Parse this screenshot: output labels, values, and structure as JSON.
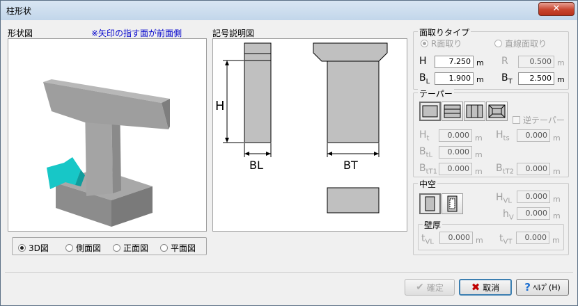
{
  "window": {
    "title": "柱形状",
    "close_label": "✕"
  },
  "shape_view": {
    "label": "形状図",
    "note": "※矢印の指す面が前面側"
  },
  "symbol_view": {
    "label": "記号説明図",
    "H": "H",
    "BL": "BL",
    "BT": "BT"
  },
  "view_modes": {
    "options": [
      "3D図",
      "側面図",
      "正面図",
      "平面図"
    ],
    "selected": "3D図"
  },
  "chamfer": {
    "title": "面取りタイプ",
    "options": [
      "R面取り",
      "直線面取り"
    ],
    "selected": "R面取り",
    "H": {
      "label": "H",
      "value": "7.250",
      "unit": "m"
    },
    "R": {
      "label": "R",
      "value": "0.500",
      "unit": "m"
    },
    "BL": {
      "label": "B",
      "sub": "L",
      "value": "1.900",
      "unit": "m"
    },
    "BT": {
      "label": "B",
      "sub": "T",
      "value": "2.500",
      "unit": "m"
    }
  },
  "taper": {
    "title": "テーパー",
    "reverse_label": "逆テーパー",
    "reverse_checked": false,
    "fields": {
      "Ht": {
        "label": "H",
        "sub": "t",
        "value": "0.000",
        "unit": "m"
      },
      "Hts": {
        "label": "H",
        "sub": "ts",
        "value": "0.000",
        "unit": "m"
      },
      "BtL": {
        "label": "B",
        "sub": "tL",
        "value": "0.000",
        "unit": "m"
      },
      "BtT1": {
        "label": "B",
        "sub": "tT1",
        "value": "0.000",
        "unit": "m"
      },
      "BtT2": {
        "label": "B",
        "sub": "tT2",
        "value": "0.000",
        "unit": "m"
      }
    }
  },
  "hollow": {
    "title": "中空",
    "HVL": {
      "label": "H",
      "sub": "VL",
      "value": "0.000",
      "unit": "m"
    },
    "hV": {
      "label": "h",
      "sub": "V",
      "value": "0.000",
      "unit": "m"
    },
    "wall": {
      "title": "壁厚",
      "tVL": {
        "label": "t",
        "sub": "VL",
        "value": "0.000",
        "unit": "m"
      },
      "tVT": {
        "label": "t",
        "sub": "VT",
        "value": "0.000",
        "unit": "m"
      }
    }
  },
  "buttons": {
    "ok": "確定",
    "cancel": "取消",
    "help": "ﾍﾙﾌﾟ(H)"
  },
  "colors": {
    "accent": "#0000cc",
    "solid_fill": "#c0c0c0",
    "arrow": "#17c7c7"
  }
}
